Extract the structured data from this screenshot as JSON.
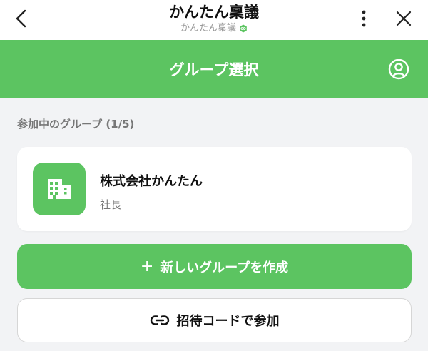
{
  "topbar": {
    "title": "かんたん稟議",
    "subtitle": "かんたん稟議",
    "icons": {
      "back": "chevron-left-icon",
      "more": "more-vertical-icon",
      "close": "close-icon",
      "badge": "verified-badge-icon"
    }
  },
  "header": {
    "title": "グループ選択",
    "profile_icon": "user-circle-icon"
  },
  "groups_section": {
    "label": "参加中のグループ (1/5)",
    "groups": [
      {
        "name": "株式会社かんたん",
        "role": "社長",
        "icon": "building-icon"
      }
    ]
  },
  "actions": {
    "create_label": "新しいグループを作成",
    "create_prefix": "+",
    "join_label": "招待コードで参加",
    "join_icon": "link-icon"
  },
  "colors": {
    "accent": "#5cc461",
    "background": "#f2f3f5",
    "card": "#ffffff"
  }
}
